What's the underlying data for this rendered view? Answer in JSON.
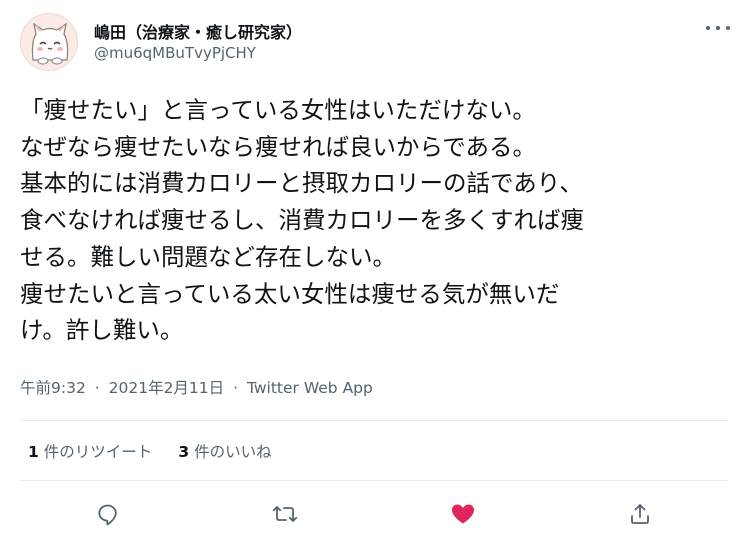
{
  "author": {
    "display_name": "嶋田（治療家・癒し研究家）",
    "handle": "@mu6qMBuTvyPjCHY",
    "avatar_icon": "cat-avatar-icon"
  },
  "tweet": {
    "lines": [
      "「痩せたい」と言っている女性はいただけない。",
      "なぜなら痩せたいなら痩せれば良いからである。",
      "基本的には消費カロリーと摂取カロリーの話であり、",
      "食べなければ痩せるし、消費カロリーを多くすれば痩",
      "せる。難しい問題など存在しない。",
      "痩せたいと言っている太い女性は痩せる気が無いだ",
      "け。許し難い。"
    ]
  },
  "meta": {
    "time": "午前9:32",
    "separator": "·",
    "date": "2021年2月11日",
    "source": "Twitter Web App"
  },
  "stats": {
    "retweets_count": "1",
    "retweets_label": "件のリツイート",
    "likes_count": "3",
    "likes_label": "件のいいね"
  },
  "colors": {
    "like_active": "#e0245e",
    "icon_gray": "#536471",
    "text": "#0f1419"
  },
  "icons": {
    "reply": "reply-icon",
    "retweet": "retweet-icon",
    "like": "heart-icon",
    "share": "share-icon",
    "more": "more-dots-icon"
  }
}
